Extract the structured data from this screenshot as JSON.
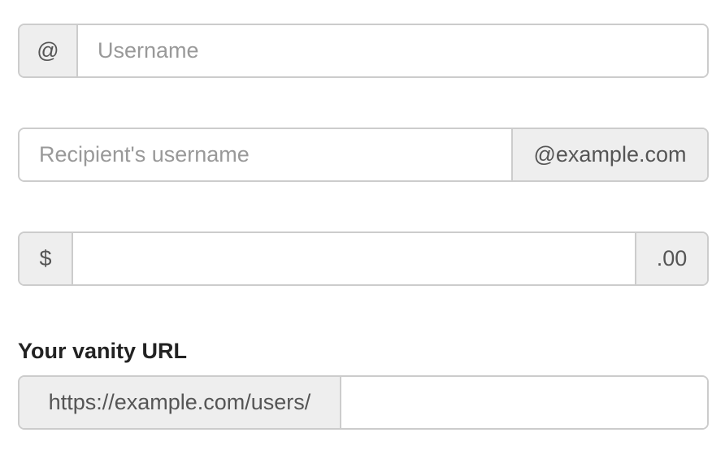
{
  "username_group": {
    "prefix": "@",
    "placeholder": "Username",
    "value": ""
  },
  "recipient_group": {
    "placeholder": "Recipient's username",
    "value": "",
    "suffix": "@example.com"
  },
  "amount_group": {
    "prefix": "$",
    "value": "",
    "suffix": ".00"
  },
  "vanity_group": {
    "label": "Your vanity URL",
    "prefix": "https://example.com/users/",
    "value": ""
  }
}
